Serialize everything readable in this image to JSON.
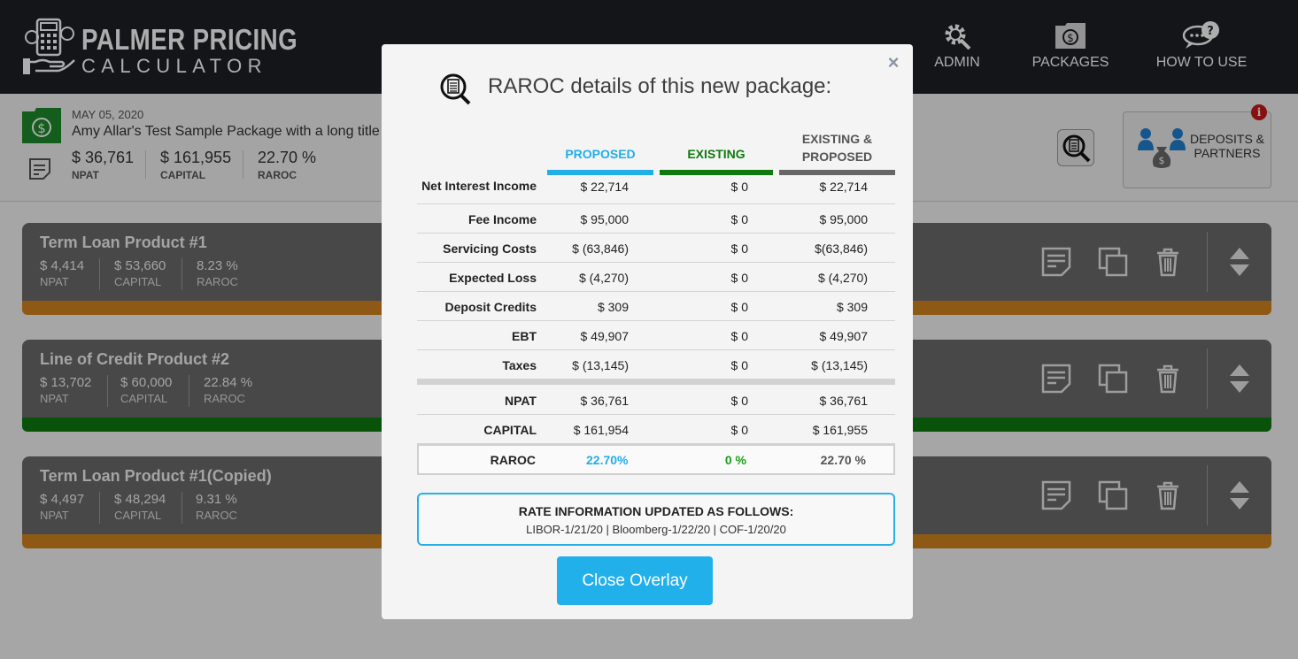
{
  "app": {
    "logo_line1": "PALMER PRICING",
    "logo_line2": "CALCULATOR",
    "nav": [
      {
        "label": "ADMIN",
        "icon": "gear-icon"
      },
      {
        "label": "PACKAGES",
        "icon": "money-folder-icon"
      },
      {
        "label": "HOW TO USE",
        "icon": "help-chat-icon"
      }
    ]
  },
  "package": {
    "date": "MAY 05, 2020",
    "title": "Amy Allar's Test Sample Package with a long title",
    "metrics": [
      {
        "value": "$ 36,761",
        "label": "NPAT"
      },
      {
        "value": "$ 161,955",
        "label": "CAPITAL"
      },
      {
        "value": "22.70 %",
        "label": "RAROC"
      }
    ],
    "deposits_label_1": "DEPOSITS &",
    "deposits_label_2": "PARTNERS",
    "info_badge": "i"
  },
  "products": [
    {
      "title": "Term Loan Product #1",
      "npat": "$ 4,414",
      "capital": "$ 53,660",
      "raroc": "8.23 %",
      "labels": [
        "NPAT",
        "CAPITAL",
        "RAROC"
      ],
      "strip_color": "#d1831f"
    },
    {
      "title": "Line of Credit Product #2",
      "npat": "$ 13,702",
      "capital": "$ 60,000",
      "raroc": "22.84 %",
      "labels": [
        "NPAT",
        "CAPITAL",
        "RAROC"
      ],
      "strip_color": "#0e7a0e"
    },
    {
      "title": "Term Loan Product #1(Copied)",
      "npat": "$ 4,497",
      "capital": "$ 48,294",
      "raroc": "9.31 %",
      "labels": [
        "NPAT",
        "CAPITAL",
        "RAROC"
      ],
      "strip_color": "#d1831f"
    }
  ],
  "modal": {
    "close_symbol": "×",
    "title": "RAROC details of this new package:",
    "columns": [
      {
        "line1": "PROPOSED",
        "line2": "",
        "color": "#22aee8"
      },
      {
        "line1": "EXISTING",
        "line2": "",
        "color": "#0e7a0e"
      },
      {
        "line1": "EXISTING &",
        "line2": "PROPOSED",
        "color": "#666666"
      }
    ],
    "rows": [
      {
        "label": "Net Interest Income",
        "proposed": "$ 22,714",
        "existing": "$ 0",
        "combined": "$ 22,714"
      },
      {
        "label": "Fee Income",
        "proposed": "$ 95,000",
        "existing": "$ 0",
        "combined": "$ 95,000"
      },
      {
        "label": "Servicing Costs",
        "proposed": "$ (63,846)",
        "existing": "$ 0",
        "combined": "$(63,846)"
      },
      {
        "label": "Expected Loss",
        "proposed": "$ (4,270)",
        "existing": "$ 0",
        "combined": "$ (4,270)"
      },
      {
        "label": "Deposit Credits",
        "proposed": "$ 309",
        "existing": "$ 0",
        "combined": "$ 309"
      },
      {
        "label": "EBT",
        "proposed": "$ 49,907",
        "existing": "$ 0",
        "combined": "$ 49,907"
      },
      {
        "label": "Taxes",
        "proposed": "$ (13,145)",
        "existing": "$ 0",
        "combined": "$ (13,145)"
      }
    ],
    "totals": [
      {
        "label": "NPAT",
        "proposed": "$ 36,761",
        "existing": "$ 0",
        "combined": "$ 36,761"
      },
      {
        "label": "CAPITAL",
        "proposed": "$ 161,954",
        "existing": "$ 0",
        "combined": "$ 161,955"
      }
    ],
    "raroc": {
      "label": "RAROC",
      "proposed": "22.70%",
      "existing": "0 %",
      "combined": "22.70 %",
      "proposed_color": "#22aee8",
      "existing_color": "#18a018",
      "combined_color": "#555555"
    },
    "rate_heading": "RATE INFORMATION UPDATED AS FOLLOWS:",
    "rate_detail": "LIBOR-1/21/20 | Bloomberg-1/22/20 | COF-1/20/20",
    "close_button": "Close Overlay"
  }
}
